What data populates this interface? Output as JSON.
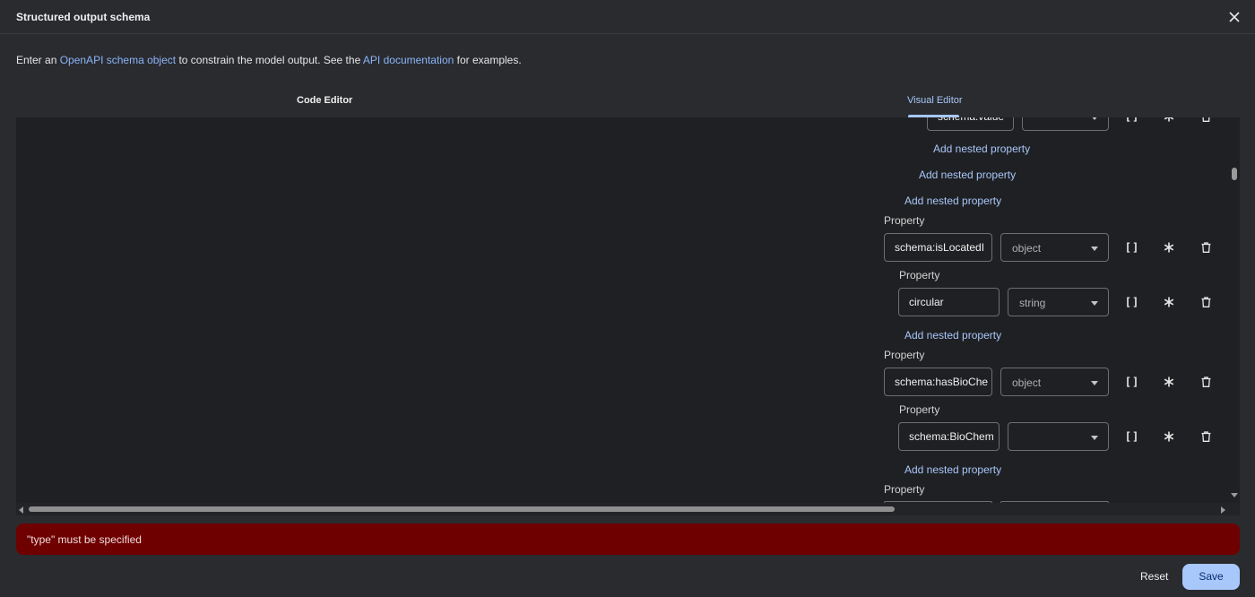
{
  "dialog": {
    "title": "Structured output schema",
    "intro": {
      "prefix": "Enter an ",
      "schema_link": "OpenAPI schema object",
      "middle": " to constrain the model output. See the ",
      "docs_link": "API documentation",
      "suffix": " for examples."
    }
  },
  "tabs": {
    "code_editor": "Code Editor",
    "visual_editor": "Visual Editor",
    "active": "Visual Editor"
  },
  "visual_editor": {
    "property_label": "Property",
    "add_nested_label": "Add nested property",
    "rows": [
      {
        "name": "schema:value",
        "type": ""
      },
      {
        "name": "schema:isLocatedI",
        "type": "object"
      },
      {
        "name": "circular",
        "type": "string"
      },
      {
        "name": "schema:hasBioChe",
        "type": "object"
      },
      {
        "name": "schema:BioChem",
        "type": ""
      }
    ]
  },
  "error": {
    "message": "\"type\" must be specified"
  },
  "footer": {
    "reset_label": "Reset",
    "save_label": "Save"
  },
  "colors": {
    "accent": "#a8c7fa",
    "error_bg": "#6e0000",
    "background": "#2a2b2f",
    "editor_bg": "#1f2023"
  },
  "icons": [
    "close-icon",
    "array-brackets-icon",
    "required-asterisk-icon",
    "delete-icon"
  ]
}
